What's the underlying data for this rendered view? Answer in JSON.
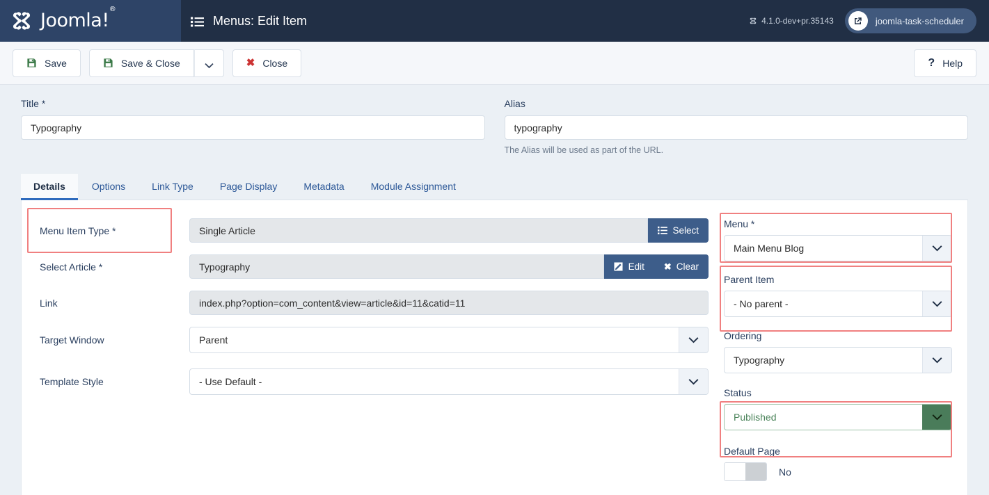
{
  "header": {
    "brand_name": "Joomla!",
    "brand_registered": "®",
    "page_title": "Menus: Edit Item",
    "version": "4.1.0-dev+pr.35143",
    "site_name": "joomla-task-scheduler",
    "menu_icon": "list-icon",
    "external_link_icon": "external-link-icon",
    "joomla_icon": "joomla-logo-icon",
    "version_icon": "joomla-mark-icon"
  },
  "toolbar": {
    "save_label": "Save",
    "save_close_label": "Save & Close",
    "save_dropdown_icon": "chevron-down-icon",
    "close_label": "Close",
    "help_label": "Help",
    "save_icon": "floppy-disk-icon",
    "close_icon": "close-x-icon",
    "help_icon": "question-mark-icon"
  },
  "top_fields": {
    "title": {
      "label": "Title *",
      "value": "Typography",
      "placeholder": ""
    },
    "alias": {
      "label": "Alias",
      "value": "typography",
      "placeholder": "",
      "help": "The Alias will be used as part of the URL."
    }
  },
  "tabs": [
    {
      "label": "Details",
      "active": true
    },
    {
      "label": "Options",
      "active": false
    },
    {
      "label": "Link Type",
      "active": false
    },
    {
      "label": "Page Display",
      "active": false
    },
    {
      "label": "Metadata",
      "active": false
    },
    {
      "label": "Module Assignment",
      "active": false
    }
  ],
  "details": {
    "menu_item_type": {
      "label": "Menu Item Type *",
      "value": "Single Article",
      "button_label": "Select",
      "button_icon": "list-icon",
      "highlighted": true
    },
    "select_article": {
      "label": "Select Article *",
      "value": "Typography",
      "edit_label": "Edit",
      "edit_icon": "pencil-square-icon",
      "clear_label": "Clear",
      "clear_icon": "close-x-icon"
    },
    "link": {
      "label": "Link",
      "value": "index.php?option=com_content&view=article&id=11&catid=11"
    },
    "target_window": {
      "label": "Target Window",
      "value": "Parent",
      "arrow_icon": "chevron-down-icon"
    },
    "template_style": {
      "label": "Template Style",
      "value": "- Use Default -",
      "arrow_icon": "chevron-down-icon"
    }
  },
  "sidebar": {
    "menu": {
      "label": "Menu *",
      "value": "Main Menu Blog",
      "arrow_icon": "chevron-down-icon",
      "highlighted": true
    },
    "parent_item": {
      "label": "Parent Item",
      "value": "- No parent -",
      "arrow_icon": "chevron-down-icon",
      "highlighted": true
    },
    "ordering": {
      "label": "Ordering",
      "value": "Typography",
      "arrow_icon": "chevron-down-icon",
      "highlighted": false
    },
    "status": {
      "label": "Status",
      "value": "Published",
      "arrow_icon": "chevron-down-icon",
      "highlighted": true
    },
    "default_page": {
      "label": "Default Page",
      "value": "No"
    }
  },
  "colors": {
    "brand_bg": "#2e4467",
    "header_bg": "#212f45",
    "page_bg": "#ebf0f5",
    "accent_blue": "#3d5d8a",
    "tab_active": "#2e6bbd",
    "status_green": "#4a7c5a",
    "highlight_red": "#f08080"
  }
}
